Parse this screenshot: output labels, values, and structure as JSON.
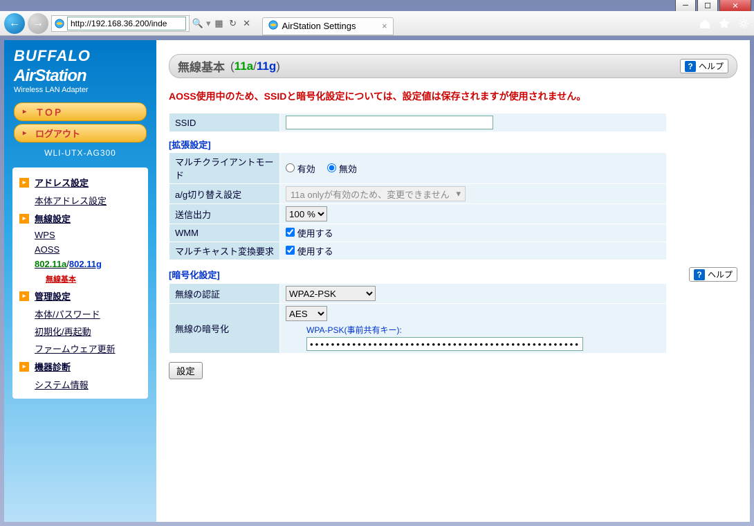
{
  "window": {
    "url": "http://192.168.36.200/inde",
    "tab_title": "AirStation Settings"
  },
  "sidebar": {
    "brand": "BUFFALO",
    "product": "AirStation",
    "sub": "Wireless LAN Adapter",
    "pill_top": "ＴＯＰ",
    "pill_logout": "ログアウト",
    "model": "WLI-UTX-AG300",
    "sec_address": "アドレス設定",
    "item_local_addr": "本体アドレス設定",
    "sec_wireless": "無線設定",
    "item_wps": "WPS",
    "item_aoss": "AOSS",
    "item_80211a": "802.11a",
    "item_80211g": "802.11g",
    "item_wireless_basic": "無線基本",
    "sec_admin": "管理設定",
    "item_password": "本体/パスワード",
    "item_reboot": "初期化/再起動",
    "item_firmware": "ファームウェア更新",
    "sec_diag": "機器診断",
    "item_sysinfo": "システム情報"
  },
  "page": {
    "title": "無線基本",
    "title_11a": "11a",
    "title_11g": "11g",
    "help": "ヘルプ",
    "warning": "AOSS使用中のため、SSIDと暗号化設定については、設定値は保存されますが使用されません。",
    "ssid_label": "SSID",
    "ssid_value": "",
    "section_ext": "[拡張設定]",
    "multiclient_label": "マルチクライアントモード",
    "radio_enable": "有効",
    "radio_disable": "無効",
    "ag_switch_label": "a/g切り替え設定",
    "ag_switch_text": "11a onlyが有効のため、変更できません",
    "txpower_label": "送信出力",
    "txpower_value": "100 %",
    "wmm_label": "WMM",
    "wmm_check": "使用する",
    "multicast_label": "マルチキャスト変換要求",
    "multicast_check": "使用する",
    "section_enc": "[暗号化設定]",
    "auth_label": "無線の認証",
    "auth_value": "WPA2-PSK",
    "enc_label": "無線の暗号化",
    "enc_value": "AES",
    "psk_label": "WPA-PSK(事前共有キー):",
    "psk_value": "••••••••••••••••••••••••••••••••••••••••••••••••••••••••••••••••",
    "submit": "設定"
  }
}
